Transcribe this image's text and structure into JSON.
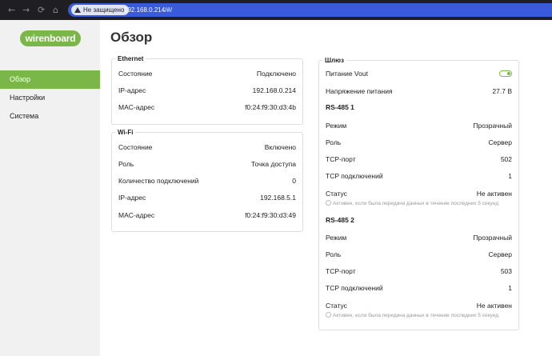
{
  "browser": {
    "nav_back": "←",
    "nav_forward": "→",
    "nav_reload": "⟳",
    "nav_home": "⌂",
    "security_label": "Не защищено",
    "url": "192.168.0.214/#/"
  },
  "colors": {
    "accent": "#7ab648",
    "chrome": "#1f1f23",
    "urlbar": "#3a5bd9"
  },
  "sidebar": {
    "logo": "wirenboard",
    "items": [
      {
        "label": "Обзор",
        "active": true
      },
      {
        "label": "Настройки"
      },
      {
        "label": "Система"
      }
    ]
  },
  "main": {
    "title": "Обзор",
    "ethernet": {
      "title": "Ethernet",
      "rows": [
        {
          "k": "Состояние",
          "v": "Подключено"
        },
        {
          "k": "IP-адрес",
          "v": "192.168.0.214"
        },
        {
          "k": "MAC-адрес",
          "v": "f0:24:f9:30:d3:4b"
        }
      ]
    },
    "wifi": {
      "title": "Wi-Fi",
      "rows": [
        {
          "k": "Состояние",
          "v": "Включено"
        },
        {
          "k": "Роль",
          "v": "Точка доступа"
        },
        {
          "k": "Количество подключений",
          "v": "0"
        },
        {
          "k": "IP-адрес",
          "v": "192.168.5.1"
        },
        {
          "k": "MAC-адрес",
          "v": "f0:24:f9:30:d3:49"
        }
      ]
    },
    "gateway": {
      "title": "Шлюз",
      "vout_label": "Питание Vout",
      "vout_on": true,
      "voltage_label": "Напряжение питания",
      "voltage_value": "27.7 В",
      "ports": [
        {
          "title": "RS-485 1",
          "rows": [
            {
              "k": "Режим",
              "v": "Прозрачный"
            },
            {
              "k": "Роль",
              "v": "Сервер"
            },
            {
              "k": "TCP-порт",
              "v": "502"
            },
            {
              "k": "TCP подключений",
              "v": "1"
            },
            {
              "k": "Статус",
              "v": "Не активен"
            }
          ],
          "hint": "Активен, если была передача данных в течение последних 5 секунд"
        },
        {
          "title": "RS-485 2",
          "rows": [
            {
              "k": "Режим",
              "v": "Прозрачный"
            },
            {
              "k": "Роль",
              "v": "Сервер"
            },
            {
              "k": "TCP-порт",
              "v": "503"
            },
            {
              "k": "TCP подключений",
              "v": "1"
            },
            {
              "k": "Статус",
              "v": "Не активен"
            }
          ],
          "hint": "Активен, если была передача данных в течение последних 5 секунд"
        }
      ]
    }
  }
}
